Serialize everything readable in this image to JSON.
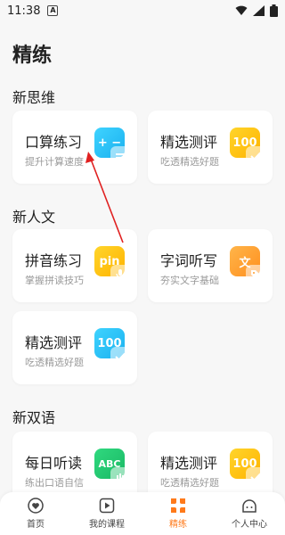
{
  "status": {
    "time": "11:38",
    "notify_icon": "A"
  },
  "page": {
    "title": "精练"
  },
  "sections": [
    {
      "title": "新思维"
    },
    {
      "title": "新人文"
    },
    {
      "title": "新双语"
    }
  ],
  "cards": {
    "kousuan": {
      "title": "口算练习",
      "sub": "提升计算速度",
      "icon_text": "+ −"
    },
    "jingxuan1": {
      "title": "精选测评",
      "sub": "吃透精选好题",
      "icon_text": "100"
    },
    "pinyin": {
      "title": "拼音练习",
      "sub": "掌握拼读技巧",
      "icon_text": "pin"
    },
    "zici": {
      "title": "字词听写",
      "sub": "夯实文字基础",
      "icon_text": "文"
    },
    "jingxuan2": {
      "title": "精选测评",
      "sub": "吃透精选好题",
      "icon_text": "100"
    },
    "meiri": {
      "title": "每日听读",
      "sub": "练出口语自信",
      "icon_text": "ABC"
    },
    "jingxuan3": {
      "title": "精选测评",
      "sub": "吃透精选好题",
      "icon_text": "100"
    }
  },
  "tabs": [
    {
      "label": "首页",
      "icon": "home-heart-icon"
    },
    {
      "label": "我的课程",
      "icon": "play-course-icon"
    },
    {
      "label": "精练",
      "icon": "grid-leaf-icon",
      "active": true
    },
    {
      "label": "个人中心",
      "icon": "profile-face-icon"
    }
  ],
  "colors": {
    "accent": "#ff7a1a",
    "cyan": "#1ab1ef",
    "yellow": "#ffb300",
    "green": "#19b864",
    "orange": "#ff8f1e"
  }
}
